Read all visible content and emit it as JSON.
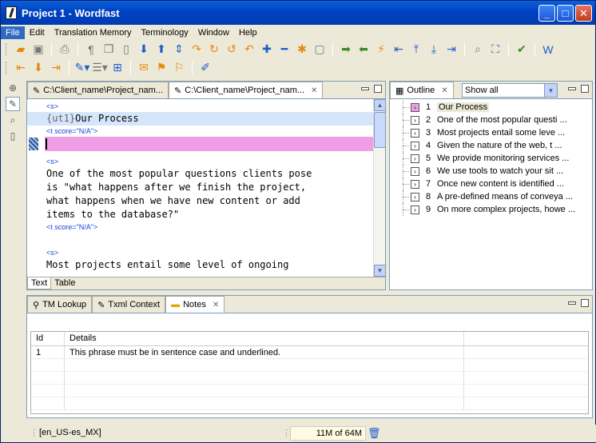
{
  "window": {
    "title": "Project 1 - Wordfast",
    "buttons": [
      "_",
      "□",
      "✕"
    ]
  },
  "menu": [
    "File",
    "Edit",
    "Translation Memory",
    "Terminology",
    "Window",
    "Help"
  ],
  "toolbar_icons": {
    "row1": [
      "open-folder-icon",
      "save-icon",
      "print-icon",
      "pilcrow-icon",
      "copy-source-icon",
      "open-segment-icon",
      "arrow-down-icon",
      "arrow-up-icon",
      "expand-icon",
      "commit-icon",
      "commit-next-icon",
      "lightning-icon",
      "undo-icon",
      "plus-icon",
      "minus-icon",
      "asterisk-icon",
      "clear-icon",
      "next-icon",
      "previous-icon",
      "flash-icon",
      "arrow-left-icon",
      "arrow-top-icon",
      "arrow-bottom-icon",
      "arrow-right-icon",
      "concordance-icon",
      "fit-icon",
      "spellcheck-icon",
      "word-icon"
    ],
    "row2": [
      "first-segment-icon",
      "down-segment-icon",
      "last-segment-icon",
      "edit-icon",
      "format-icon",
      "split-icon",
      "merge-icon",
      "note-icon",
      "flag-icon",
      "check-icon"
    ]
  },
  "editor": {
    "tabs": [
      {
        "label": "C:\\Client_name\\Project_nam...",
        "active": false
      },
      {
        "label": "C:\\Client_name\\Project_nam...",
        "active": true
      }
    ],
    "tag_s": "<s>",
    "segment_prefix": "{ut1}",
    "segment_source": "Our Process",
    "tag_score": "<t score=\"N/A\">",
    "paragraph1": "One of the most popular questions clients pose\nis \"what happens after we finish the project,\nwhat happens when we have new content or add\nitems to the database?\"",
    "tag_score2": "<t score=\"N/A\">",
    "tag_s2": "<s>",
    "paragraph2": "Most projects entail some level of ongoing",
    "bottom_tabs": [
      "Text",
      "Table"
    ]
  },
  "outline": {
    "tab_label": "Outline",
    "filter_value": "Show all",
    "items": [
      {
        "num": "1",
        "text": "Our Process"
      },
      {
        "num": "2",
        "text": "One of the most popular questi ..."
      },
      {
        "num": "3",
        "text": "Most projects entail some leve ..."
      },
      {
        "num": "4",
        "text": "Given the nature of the web, t ..."
      },
      {
        "num": "5",
        "text": "We provide monitoring services ..."
      },
      {
        "num": "6",
        "text": "We use tools to watch your sit ..."
      },
      {
        "num": "7",
        "text": "Once new content is identified ..."
      },
      {
        "num": "8",
        "text": "A pre-defined means of conveya ..."
      },
      {
        "num": "9",
        "text": "On more complex projects, howe ..."
      }
    ]
  },
  "bottom_panel": {
    "tabs": [
      "TM Lookup",
      "Txml Context",
      "Notes"
    ],
    "columns": [
      "Id",
      "Details"
    ],
    "rows": [
      {
        "id": "1",
        "details": "This phrase must be in sentence case and underlined."
      }
    ]
  },
  "status": {
    "language": "[en_US-es_MX]",
    "memory": "11M of 64M"
  }
}
